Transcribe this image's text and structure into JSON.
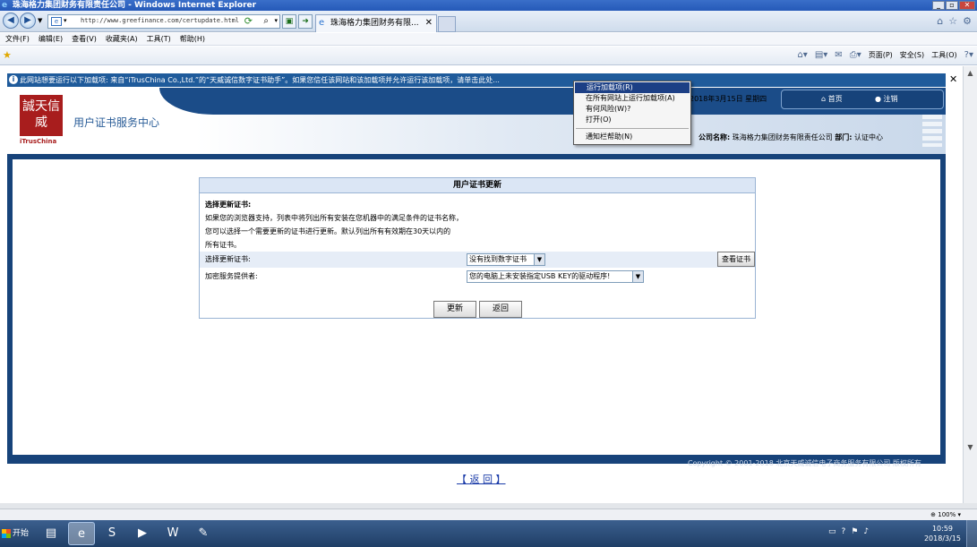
{
  "window": {
    "title": "珠海格力集团财务有限责任公司 - Windows Internet Explorer",
    "minimize": "_",
    "maximize": "▫",
    "close": "✕"
  },
  "navbar": {
    "url": "http://www.greefinance.com/certupdate.html",
    "tab_title": "珠海格力集团财务有限...",
    "tab_close": "✕"
  },
  "menu": {
    "items": [
      "文件(F)",
      "编辑(E)",
      "查看(V)",
      "收藏夹(A)",
      "工具(T)",
      "帮助(H)"
    ]
  },
  "commandbar": {
    "page": "页面(P)",
    "safety": "安全(S)",
    "tools": "工具(O)"
  },
  "infobar": {
    "text": "此网站想要运行以下加载项: 来自“iTrusChina Co.,Ltd.”的“天威诚信数字证书助手”。如果您信任该网站和该加载项并允许运行该加载项，请单击此处..."
  },
  "context_menu": {
    "items": [
      {
        "label": "运行加载项(R)",
        "highlighted": true
      },
      {
        "label": "在所有网站上运行加载项(A)",
        "highlighted": false
      },
      {
        "label": "有何风险(W)?",
        "highlighted": false
      },
      {
        "label": "打开(O)",
        "highlighted": false
      },
      {
        "label": "通知栏帮助(N)",
        "highlighted": false
      }
    ]
  },
  "site": {
    "logo_chars": "誠天信威",
    "logo_brand": "iTrusChina",
    "title": "用户证书服务中心",
    "date": "2018年3月15日 星期四",
    "home": "首页",
    "logout": "注销",
    "company_label": "公司名称:",
    "company_name": "珠海格力集团财务有限责任公司",
    "dept_label": "部门:",
    "dept_name": "认证中心",
    "copyright": "Copyright © 2001-2018 北京天威诚信电子商务服务有限公司 版权所有"
  },
  "form": {
    "title": "用户证书更新",
    "desc_heading": "选择更新证书:",
    "desc_lines": [
      "如果您的浏览器支持，列表中将列出所有安装在您机器中的满足条件的证书名称，",
      "您可以选择一个需要更新的证书进行更新。默认列出所有有效期在30天以内的",
      "所有证书。"
    ],
    "cert_label": "选择更新证书:",
    "cert_value": "没有找到数字证书",
    "view_cert": "查看证书",
    "csp_label": "加密服务提供者:",
    "csp_value": "您的电脑上未安装指定USB KEY的驱动程序!",
    "update_btn": "更新",
    "back_btn": "返回"
  },
  "page_back_link": "【 返 回 】",
  "status": {
    "zoom": "100%"
  },
  "taskbar": {
    "start": "开始",
    "time": "10:59",
    "date": "2018/3/15"
  },
  "colors": {
    "site_navy": "#17437a",
    "infobar": "#1f5b9b",
    "logo_red": "#a81d1d",
    "menu_highlight": "#1c3f85"
  }
}
